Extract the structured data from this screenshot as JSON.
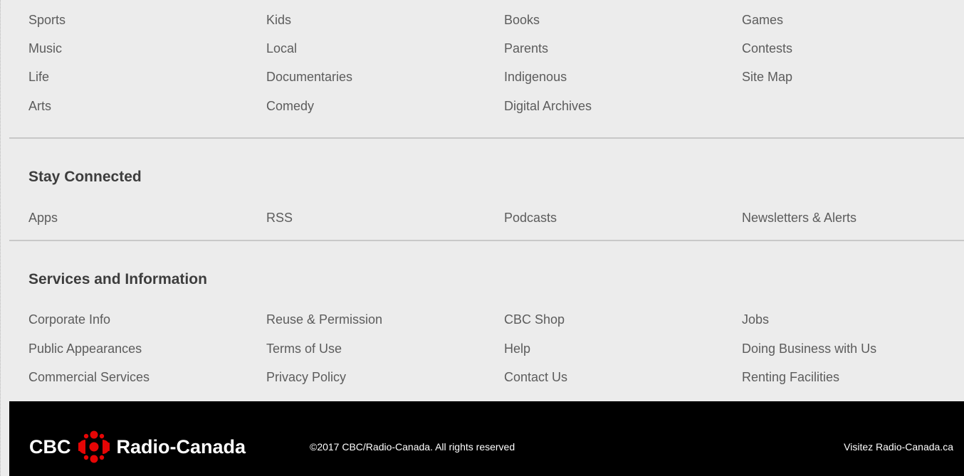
{
  "top_links": {
    "col1": [
      "Sports",
      "Music",
      "Life",
      "Arts"
    ],
    "col2": [
      "Kids",
      "Local",
      "Documentaries",
      "Comedy"
    ],
    "col3": [
      "Books",
      "Parents",
      "Indigenous",
      "Digital Archives"
    ],
    "col4": [
      "Games",
      "Contests",
      "Site Map"
    ]
  },
  "stay_connected": {
    "heading": "Stay Connected",
    "links": [
      "Apps",
      "RSS",
      "Podcasts",
      "Newsletters & Alerts"
    ]
  },
  "services": {
    "heading": "Services and Information",
    "col1": [
      "Corporate Info",
      "Public Appearances",
      "Commercial Services"
    ],
    "col2": [
      "Reuse & Permission",
      "Terms of Use",
      "Privacy Policy"
    ],
    "col3": [
      "CBC Shop",
      "Help",
      "Contact Us"
    ],
    "col4": [
      "Jobs",
      "Doing Business with Us",
      "Renting Facilities"
    ]
  },
  "footer": {
    "brand_left": "CBC",
    "brand_right": "Radio-Canada",
    "logo_icon": "cbc-gem-icon",
    "copyright": "©2017 CBC/Radio-Canada. All rights reserved",
    "visit_link": "Visitez Radio-Canada.ca"
  },
  "colors": {
    "background": "#ececec",
    "footer_bg": "#000000",
    "logo_red": "#e60505",
    "link_text": "#5c5c5c",
    "heading_text": "#3d3d3d"
  }
}
